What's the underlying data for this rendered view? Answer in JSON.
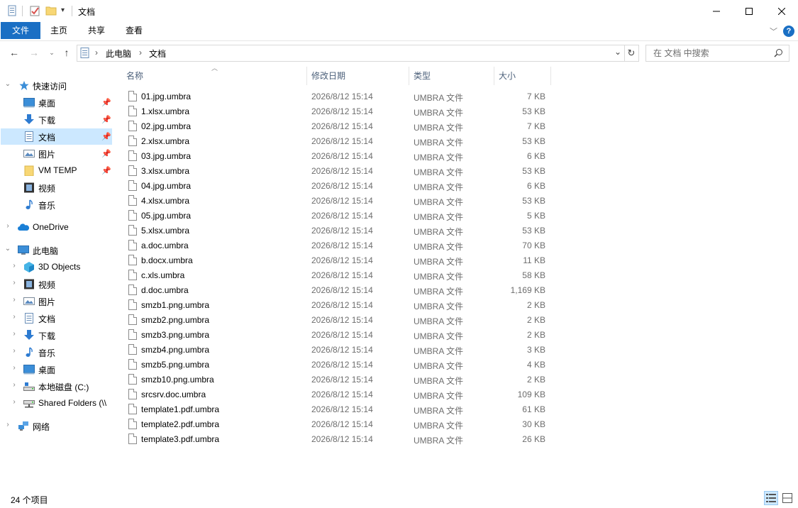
{
  "window": {
    "title": "文档",
    "colors": {
      "accent": "#1a6fc4",
      "selection": "#cce8ff",
      "help": "#1a6fc4"
    }
  },
  "ribbon": {
    "tabs": [
      {
        "label": "文件"
      },
      {
        "label": "主页"
      },
      {
        "label": "共享"
      },
      {
        "label": "查看"
      }
    ]
  },
  "address": {
    "crumbs": [
      "此电脑",
      "文档"
    ],
    "separator": "›"
  },
  "search": {
    "placeholder": "在 文档 中搜索"
  },
  "navpane": {
    "quick_access": {
      "label": "快速访问"
    },
    "quick_items": [
      {
        "label": "桌面",
        "icon": "desktop-icon",
        "pinned": true
      },
      {
        "label": "下载",
        "icon": "download-icon",
        "pinned": true
      },
      {
        "label": "文档",
        "icon": "documents-icon",
        "pinned": true,
        "selected": true
      },
      {
        "label": "图片",
        "icon": "pictures-icon",
        "pinned": true
      },
      {
        "label": "VM TEMP",
        "icon": "folder-icon",
        "pinned": true
      },
      {
        "label": "视频",
        "icon": "videos-icon",
        "pinned": false
      },
      {
        "label": "音乐",
        "icon": "music-icon",
        "pinned": false
      }
    ],
    "onedrive": {
      "label": "OneDrive"
    },
    "this_pc": {
      "label": "此电脑"
    },
    "pc_items": [
      {
        "label": "3D Objects",
        "icon": "3d-objects-icon"
      },
      {
        "label": "视频",
        "icon": "videos-icon"
      },
      {
        "label": "图片",
        "icon": "pictures-icon"
      },
      {
        "label": "文档",
        "icon": "documents-icon"
      },
      {
        "label": "下载",
        "icon": "download-icon"
      },
      {
        "label": "音乐",
        "icon": "music-icon"
      },
      {
        "label": "桌面",
        "icon": "desktop-icon"
      },
      {
        "label": "本地磁盘 (C:)",
        "icon": "drive-icon"
      },
      {
        "label": "Shared Folders (\\\\",
        "icon": "network-drive-icon"
      }
    ],
    "network": {
      "label": "网络"
    }
  },
  "filelist": {
    "columns": {
      "name": "名称",
      "date": "修改日期",
      "type": "类型",
      "size": "大小"
    },
    "files": [
      {
        "name": "01.jpg.umbra",
        "date": "2026/8/12 15:14",
        "type": "UMBRA 文件",
        "size": "7 KB"
      },
      {
        "name": "1.xlsx.umbra",
        "date": "2026/8/12 15:14",
        "type": "UMBRA 文件",
        "size": "53 KB"
      },
      {
        "name": "02.jpg.umbra",
        "date": "2026/8/12 15:14",
        "type": "UMBRA 文件",
        "size": "7 KB"
      },
      {
        "name": "2.xlsx.umbra",
        "date": "2026/8/12 15:14",
        "type": "UMBRA 文件",
        "size": "53 KB"
      },
      {
        "name": "03.jpg.umbra",
        "date": "2026/8/12 15:14",
        "type": "UMBRA 文件",
        "size": "6 KB"
      },
      {
        "name": "3.xlsx.umbra",
        "date": "2026/8/12 15:14",
        "type": "UMBRA 文件",
        "size": "53 KB"
      },
      {
        "name": "04.jpg.umbra",
        "date": "2026/8/12 15:14",
        "type": "UMBRA 文件",
        "size": "6 KB"
      },
      {
        "name": "4.xlsx.umbra",
        "date": "2026/8/12 15:14",
        "type": "UMBRA 文件",
        "size": "53 KB"
      },
      {
        "name": "05.jpg.umbra",
        "date": "2026/8/12 15:14",
        "type": "UMBRA 文件",
        "size": "5 KB"
      },
      {
        "name": "5.xlsx.umbra",
        "date": "2026/8/12 15:14",
        "type": "UMBRA 文件",
        "size": "53 KB"
      },
      {
        "name": "a.doc.umbra",
        "date": "2026/8/12 15:14",
        "type": "UMBRA 文件",
        "size": "70 KB"
      },
      {
        "name": "b.docx.umbra",
        "date": "2026/8/12 15:14",
        "type": "UMBRA 文件",
        "size": "11 KB"
      },
      {
        "name": "c.xls.umbra",
        "date": "2026/8/12 15:14",
        "type": "UMBRA 文件",
        "size": "58 KB"
      },
      {
        "name": "d.doc.umbra",
        "date": "2026/8/12 15:14",
        "type": "UMBRA 文件",
        "size": "1,169 KB"
      },
      {
        "name": "smzb1.png.umbra",
        "date": "2026/8/12 15:14",
        "type": "UMBRA 文件",
        "size": "2 KB"
      },
      {
        "name": "smzb2.png.umbra",
        "date": "2026/8/12 15:14",
        "type": "UMBRA 文件",
        "size": "2 KB"
      },
      {
        "name": "smzb3.png.umbra",
        "date": "2026/8/12 15:14",
        "type": "UMBRA 文件",
        "size": "2 KB"
      },
      {
        "name": "smzb4.png.umbra",
        "date": "2026/8/12 15:14",
        "type": "UMBRA 文件",
        "size": "3 KB"
      },
      {
        "name": "smzb5.png.umbra",
        "date": "2026/8/12 15:14",
        "type": "UMBRA 文件",
        "size": "4 KB"
      },
      {
        "name": "smzb10.png.umbra",
        "date": "2026/8/12 15:14",
        "type": "UMBRA 文件",
        "size": "2 KB"
      },
      {
        "name": "srcsrv.doc.umbra",
        "date": "2026/8/12 15:14",
        "type": "UMBRA 文件",
        "size": "109 KB"
      },
      {
        "name": "template1.pdf.umbra",
        "date": "2026/8/12 15:14",
        "type": "UMBRA 文件",
        "size": "61 KB"
      },
      {
        "name": "template2.pdf.umbra",
        "date": "2026/8/12 15:14",
        "type": "UMBRA 文件",
        "size": "30 KB"
      },
      {
        "name": "template3.pdf.umbra",
        "date": "2026/8/12 15:14",
        "type": "UMBRA 文件",
        "size": "26 KB"
      }
    ]
  },
  "status": {
    "item_count": "24 个项目"
  }
}
